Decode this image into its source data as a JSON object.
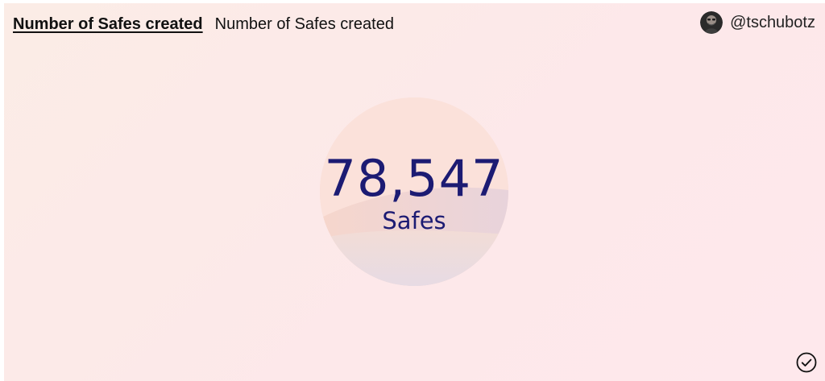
{
  "header": {
    "title_link": "Number of Safes created",
    "subtitle": "Number of Safes created"
  },
  "user": {
    "handle": "@tschubotz",
    "avatar_icon": "user-avatar"
  },
  "metric": {
    "value": "78,547",
    "unit": "Safes"
  },
  "status": {
    "icon": "check-circle-icon"
  },
  "colors": {
    "background": "#fde8ea",
    "metric_text": "#1c1b73",
    "header_text": "#111111"
  }
}
